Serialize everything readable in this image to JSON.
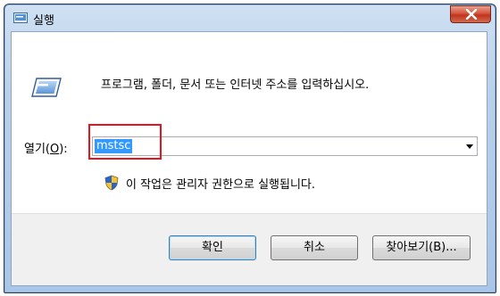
{
  "window": {
    "title": "실행",
    "icon": "run-dialog-icon",
    "close_symbol": "x"
  },
  "dialog": {
    "prompt": "프로그램, 폴더, 문서 또는 인터넷 주소를 입력하십시오.",
    "open_label": "열기(",
    "open_label_key": "O",
    "open_label_end": "):",
    "open_value": "mstsc",
    "admin_note": "이 작업은 관리자 권한으로 실행됩니다."
  },
  "buttons": {
    "ok": "확인",
    "cancel": "취소",
    "browse": "찾아보기(B)..."
  },
  "colors": {
    "accent_selection": "#3399ff",
    "highlight_box": "#e8141c",
    "close_button": "#c1331b"
  }
}
